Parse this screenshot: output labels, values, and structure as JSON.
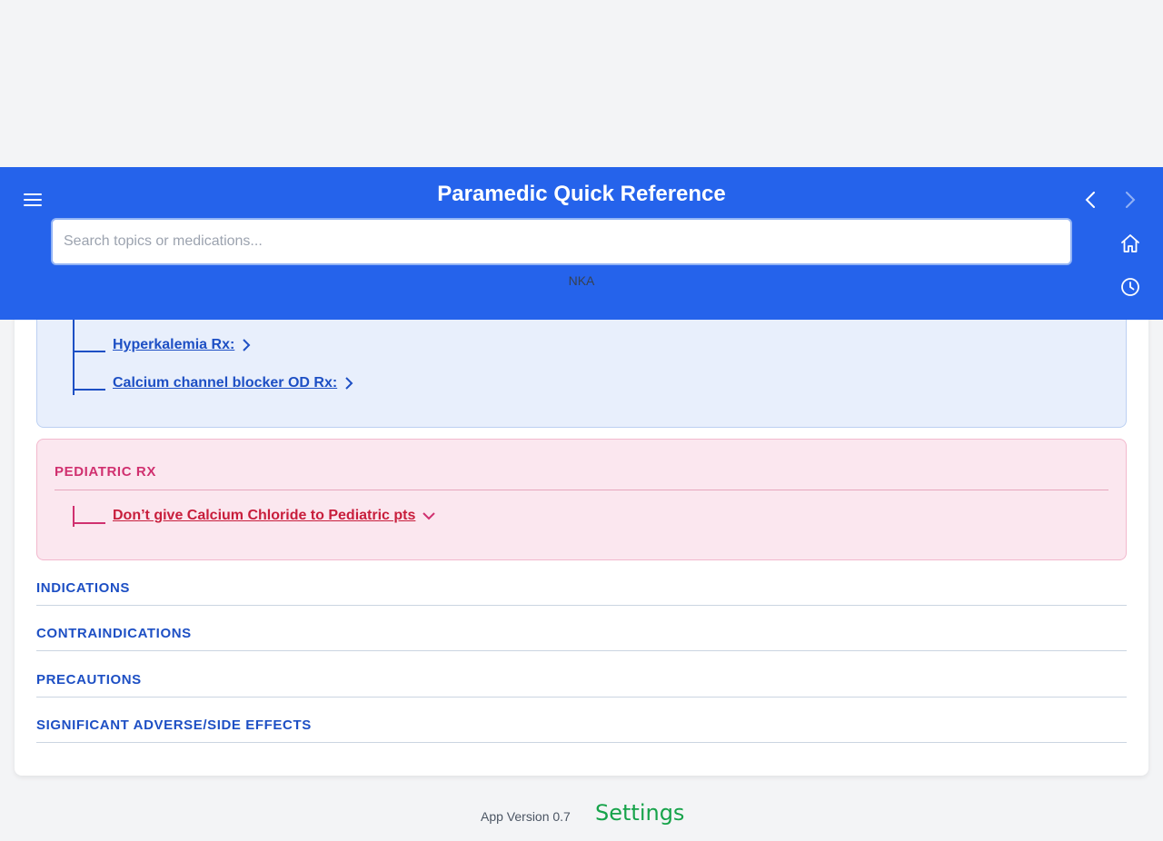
{
  "app": {
    "title": "Paramedic Quick Reference",
    "status_text": "NKA"
  },
  "search": {
    "placeholder": "Search topics or medications...",
    "value": ""
  },
  "icons": {
    "menu": "hamburger-menu-icon",
    "back": "chevron-left-icon",
    "forward": "chevron-right-icon",
    "home": "home-icon",
    "history": "clock-icon"
  },
  "adult_rx": {
    "links": [
      {
        "label": "Hyperkalemia Rx:",
        "icon": "chevron-right-icon"
      },
      {
        "label": "Calcium channel blocker OD Rx:",
        "icon": "chevron-right-icon"
      }
    ]
  },
  "pediatric_rx": {
    "title": "PEDIATRIC RX",
    "links": [
      {
        "label": "Don’t give Calcium Chloride to Pediatric pts",
        "icon": "chevron-down-icon"
      }
    ]
  },
  "sections": [
    {
      "label": "INDICATIONS"
    },
    {
      "label": "CONTRAINDICATIONS"
    },
    {
      "label": "PRECAUTIONS"
    },
    {
      "label": "SIGNIFICANT ADVERSE/SIDE EFFECTS"
    }
  ],
  "footer": {
    "version": "App Version 0.7",
    "settings_label": "Settings"
  },
  "colors": {
    "header_bg": "#2563eb",
    "link_blue": "#1d4fc4",
    "pediatric_pink": "#d0306f",
    "pediatric_link_red": "#c81e3c",
    "settings_green": "#16a34a"
  }
}
